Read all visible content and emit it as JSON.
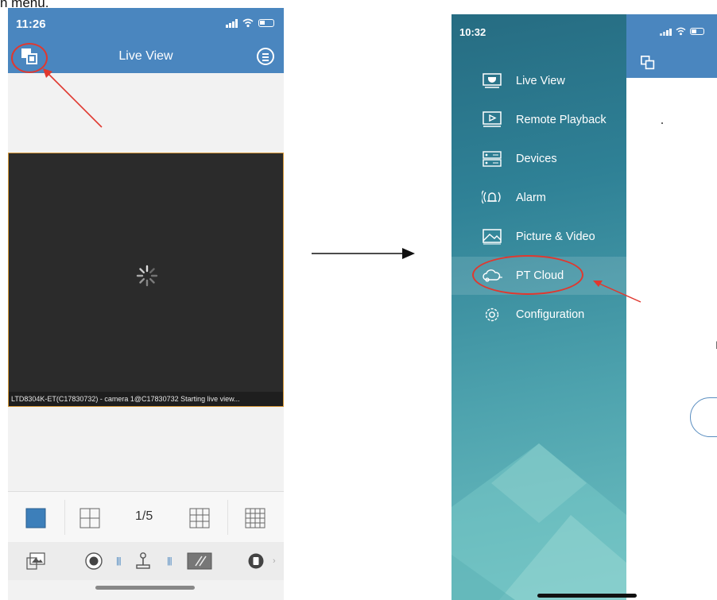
{
  "caption": "n menu.",
  "left_phone": {
    "status_time": "11:26",
    "title": "Live View",
    "video_caption": "LTD8304K-ET(C17830732) - camera 1@C17830732 Starting live view...",
    "page_indicator": "1/5",
    "icons": [
      "menu-toggle-icon",
      "list-menu-icon",
      "loading-spinner-icon",
      "layout-1-icon",
      "layout-4-icon",
      "layout-9-icon",
      "layout-16-icon",
      "snapshot-icon",
      "record-icon",
      "ptz-joystick-icon",
      "digital-zoom-icon",
      "stop-icon"
    ]
  },
  "right_phone": {
    "status_time": "10:32",
    "drawer_items": [
      {
        "label": "Live View",
        "icon": "camera-dome-icon"
      },
      {
        "label": "Remote Playback",
        "icon": "playback-icon"
      },
      {
        "label": "Devices",
        "icon": "devices-icon"
      },
      {
        "label": "Alarm",
        "icon": "alarm-bell-icon"
      },
      {
        "label": "Picture & Video",
        "icon": "picture-icon"
      },
      {
        "label": "PT Cloud",
        "icon": "cloud-icon"
      },
      {
        "label": "Configuration",
        "icon": "gear-icon"
      }
    ],
    "active_item": "PT Cloud",
    "partial_text": "F"
  },
  "colors": {
    "header_blue": "#4a86bf",
    "annotation_red": "#e0382f",
    "drawer_teal": "#2f8196"
  }
}
